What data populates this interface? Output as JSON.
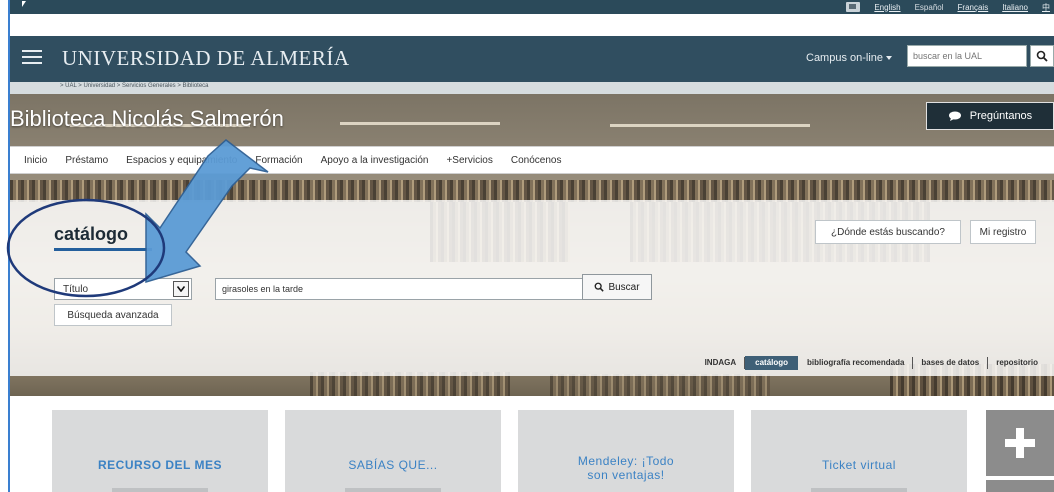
{
  "language_bar": {
    "languages": [
      "English",
      "Español",
      "Français",
      "Italiano",
      "中"
    ],
    "current": "Español"
  },
  "header": {
    "university": "UNIVERSIDAD DE ALMERÍA",
    "campus_label": "Campus on-line",
    "search_placeholder": "buscar en la UAL"
  },
  "breadcrumb": ">  UAL  >  Universidad  >  Servicios Generales  >  Biblioteca",
  "library": {
    "title": "Biblioteca Nicolás Salmerón",
    "ask_label": "Pregúntanos"
  },
  "nav": {
    "items": [
      "Inicio",
      "Préstamo",
      "Espacios y equipamiento",
      "Formación",
      "Apoyo a la investigación",
      "+Servicios",
      "Conócenos"
    ]
  },
  "catalog": {
    "title": "catálogo",
    "where_label": "¿Dónde estás buscando?",
    "register_label": "Mi registro",
    "field_selected": "Título",
    "query_value": "girasoles en la tarde",
    "search_label": "Buscar",
    "advanced_label": "Búsqueda avanzada",
    "tabs": [
      "INDAGA",
      "catálogo",
      "bibliografía recomendada",
      "bases de datos",
      "repositorio"
    ],
    "active_tab": "catálogo"
  },
  "cards": [
    {
      "title": "RECURSO DEL MES"
    },
    {
      "title": "SABÍAS QUE..."
    },
    {
      "title": "Mendeley: ¡Todo son ventajas!"
    },
    {
      "title": "Ticket virtual"
    }
  ],
  "colors": {
    "header_bg": "#304e60",
    "accent_blue": "#3b82c4",
    "annotation_blue": "#5b9bd5",
    "circle_navy": "#1f3a7a"
  }
}
